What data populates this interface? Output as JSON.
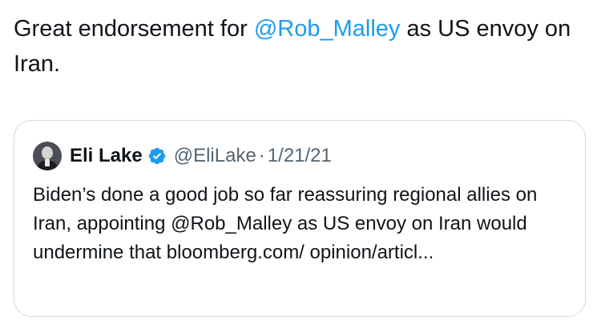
{
  "tweet": {
    "text_before": "Great endorsement for ",
    "mention": "@Rob_Malley",
    "text_after": " as US envoy on Iran."
  },
  "quote": {
    "display_name": "Eli Lake",
    "verified_icon": "verified-badge-icon",
    "handle": "@EliLake",
    "separator": "·",
    "date": "1/21/21",
    "text_before": "Biden’s done a good job so far reassuring regional allies on Iran, appointing ",
    "mention": "@Rob_Malley",
    "text_after": " as US envoy on Iran would undermine that bloomberg.com/ opinion/articl..."
  },
  "colors": {
    "mention": "#1d9bf0",
    "verified": "#1d9bf0",
    "secondary_text": "#536471",
    "primary_text": "#0f1419",
    "border": "#cfd9de"
  }
}
